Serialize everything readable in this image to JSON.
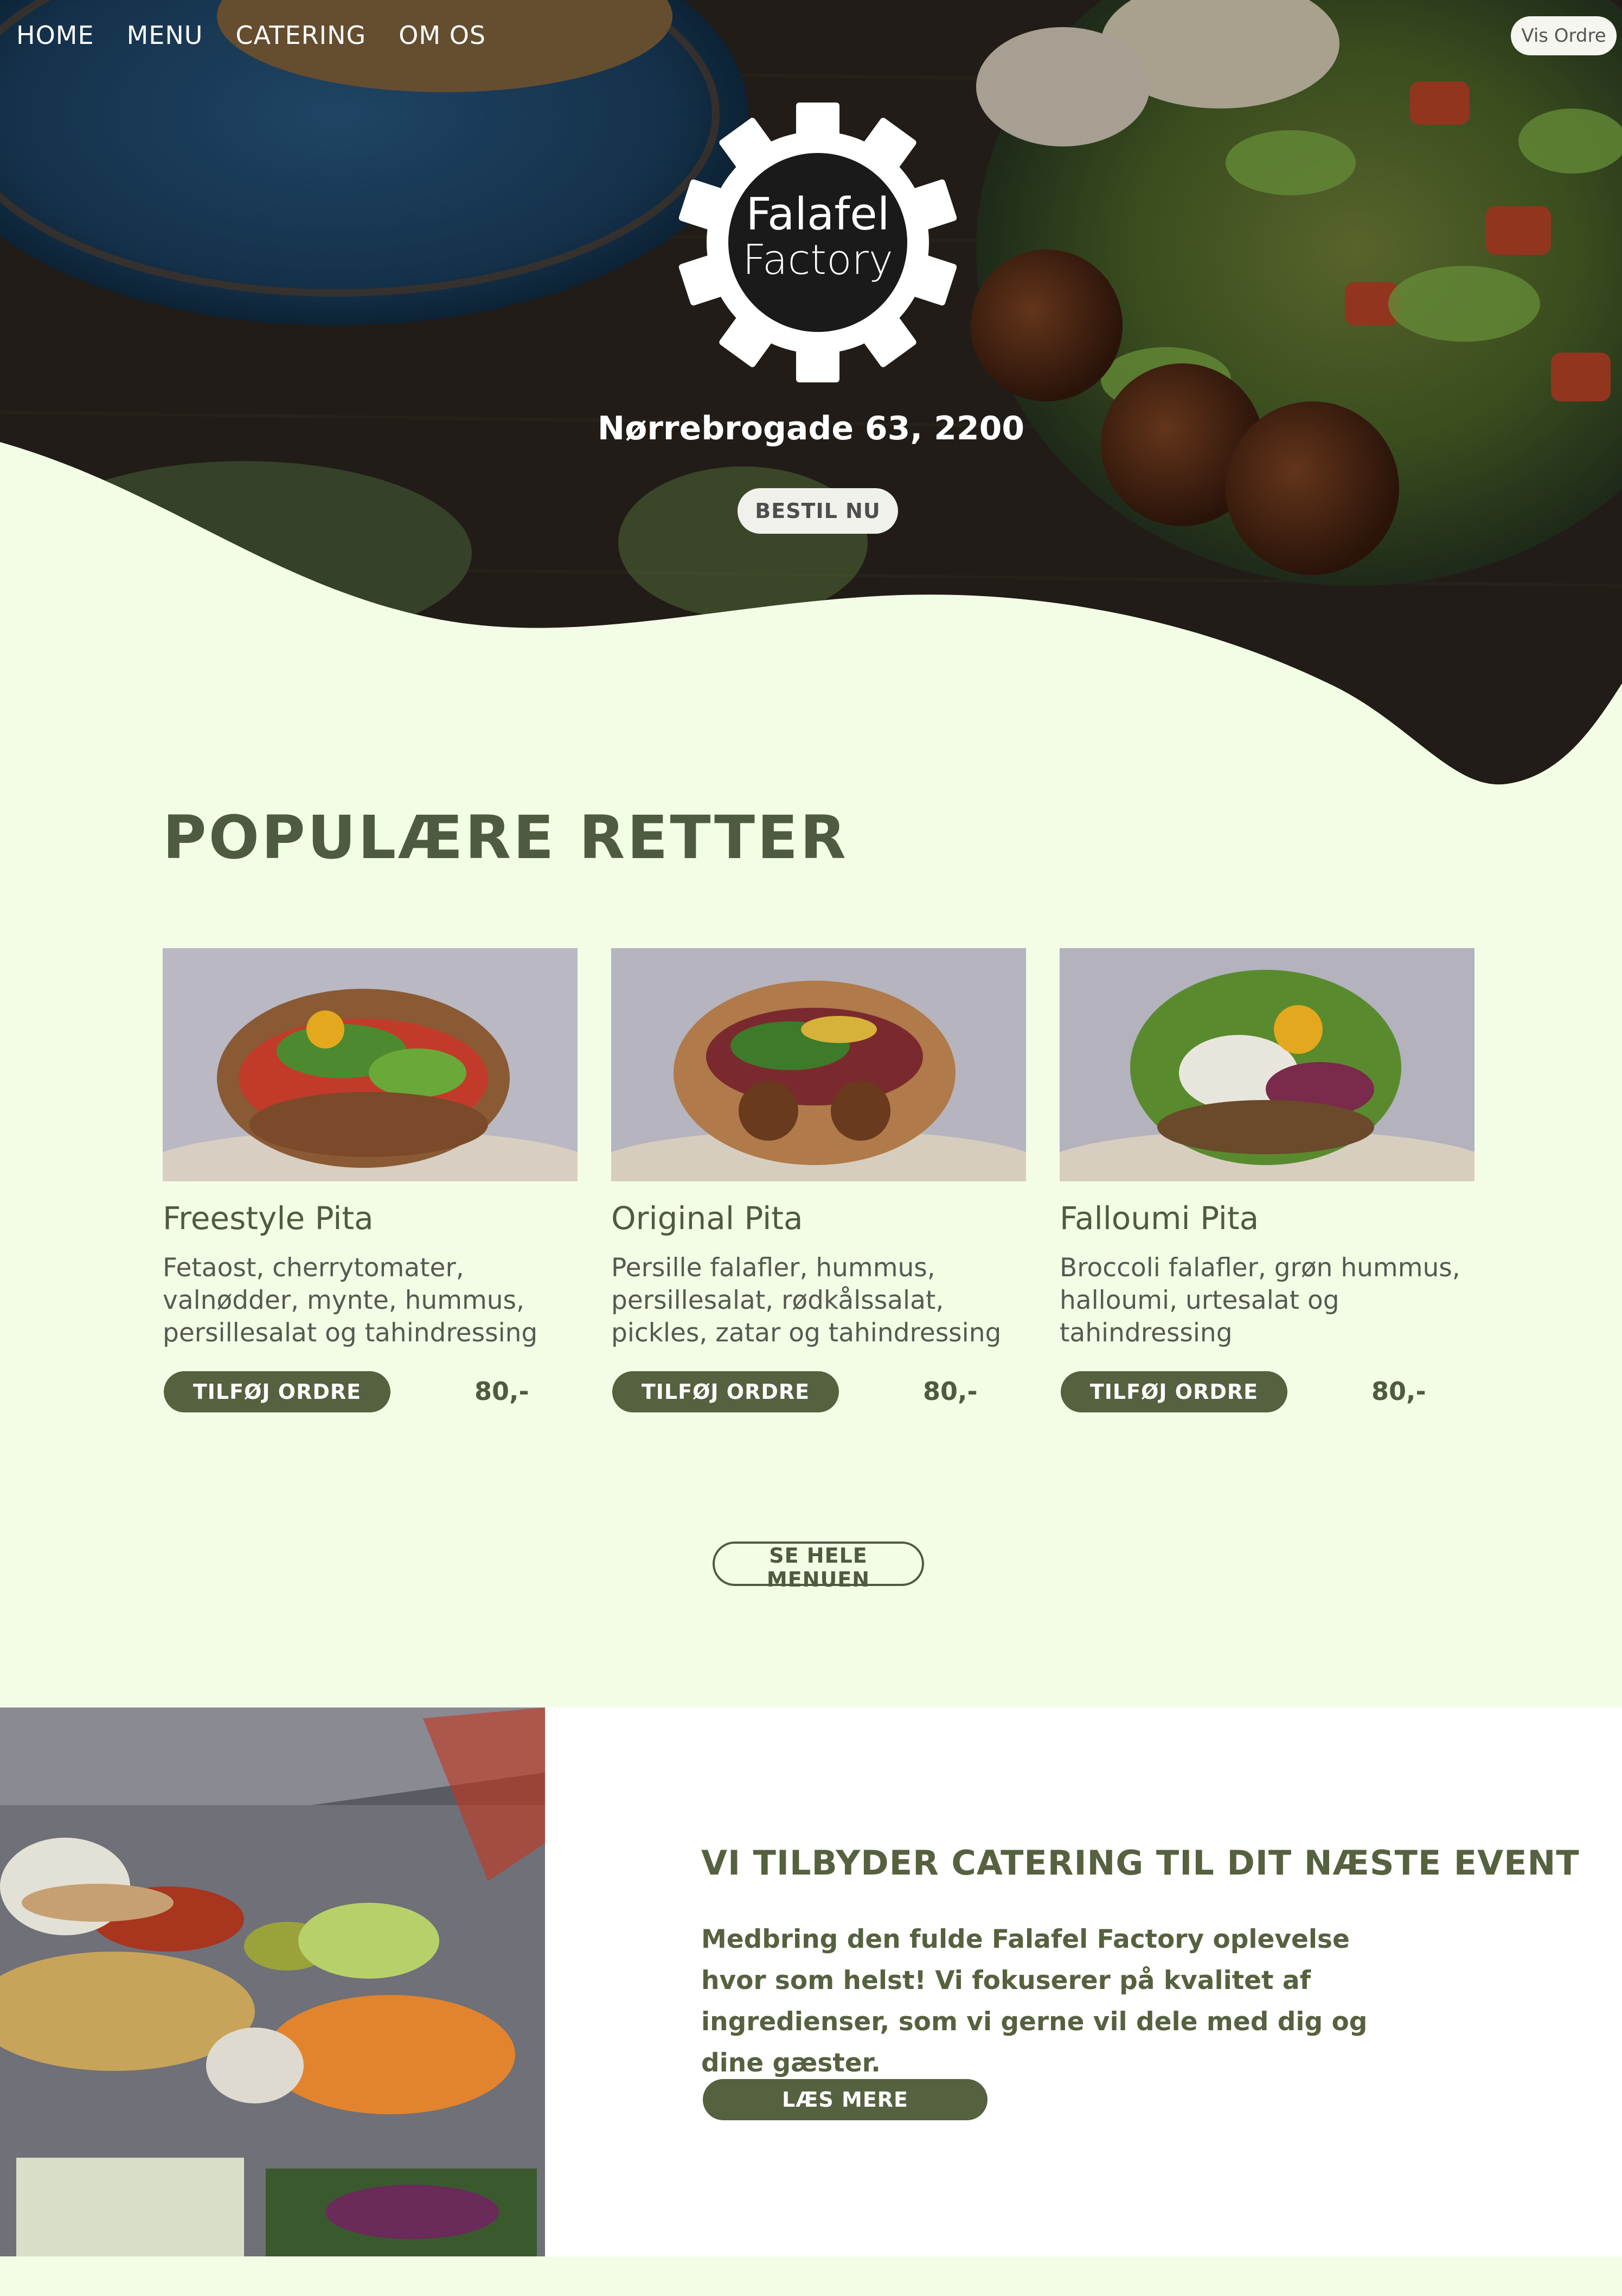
{
  "nav": {
    "items": [
      "HOME",
      "MENU",
      "CATERING",
      "OM OS"
    ],
    "vis_ordre": "Vis Ordre"
  },
  "hero": {
    "logo_line1": "Falafel",
    "logo_line2": "Factory",
    "address": "Nørrebrogade 63, 2200",
    "cta": "BESTIL NU"
  },
  "popular": {
    "title": "POPULÆRE RETTER",
    "items": [
      {
        "name": "Freestyle Pita",
        "desc": "Fetaost, cherrytomater, valnødder, mynte, hummus, persillesalat og tahindressing",
        "button": "TILFØJ ORDRE",
        "price": "80,-"
      },
      {
        "name": "Original Pita",
        "desc": "Persille falafler, hummus, persillesalat, rødkålssalat, pickles, zatar og tahindressing",
        "button": "TILFØJ ORDRE",
        "price": "80,-"
      },
      {
        "name": "Falloumi Pita",
        "desc": "Broccoli falafler, grøn hummus, halloumi, urtesalat og tahindressing",
        "button": "TILFØJ ORDRE",
        "price": "80,-"
      }
    ],
    "see_all": "SE HELE MENUEN"
  },
  "catering": {
    "title": "VI TILBYDER CATERING TIL DIT NÆSTE EVENT",
    "text": "Medbring den fulde Falafel Factory oplevelse hvor som helst! Vi fokuserer på kvalitet af ingredienser, som vi gerne vil dele med dig og dine gæster.",
    "button": "LÆS MERE"
  },
  "colors": {
    "page_bg": "#f3fde6",
    "primary": "#55613f",
    "heading": "#4f5b40",
    "white": "#ffffff"
  },
  "icons": [
    "gear-logo-icon"
  ]
}
